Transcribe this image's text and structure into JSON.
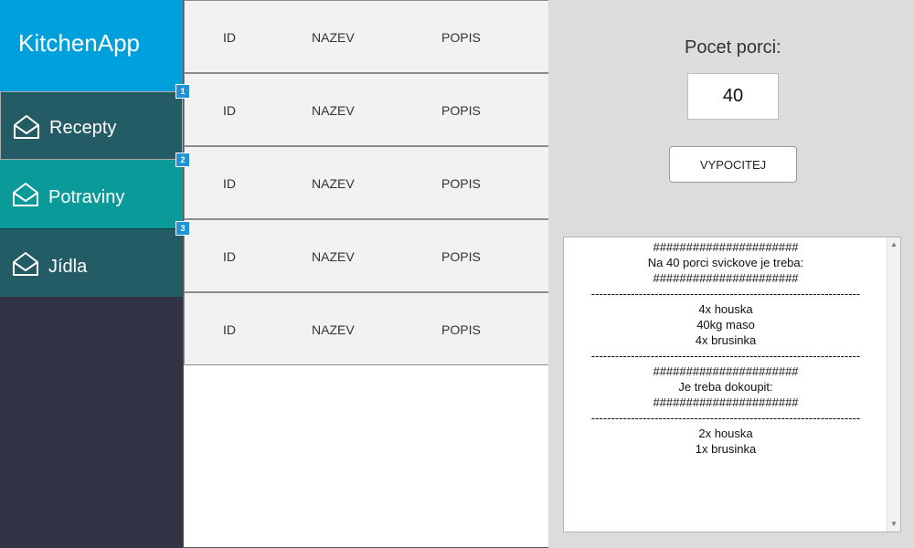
{
  "app": {
    "title": "KitchenApp"
  },
  "sidebar": {
    "items": [
      {
        "label": "Recepty",
        "badge": "1",
        "icon": "envelope-open-icon"
      },
      {
        "label": "Potraviny",
        "badge": "2",
        "icon": "envelope-open-icon"
      },
      {
        "label": "Jídla",
        "badge": "3",
        "icon": "envelope-open-icon"
      }
    ]
  },
  "list": {
    "rows": [
      {
        "id": "ID",
        "nazev": "NAZEV",
        "popis": "POPIS"
      },
      {
        "id": "ID",
        "nazev": "NAZEV",
        "popis": "POPIS"
      },
      {
        "id": "ID",
        "nazev": "NAZEV",
        "popis": "POPIS"
      },
      {
        "id": "ID",
        "nazev": "NAZEV",
        "popis": "POPIS"
      },
      {
        "id": "ID",
        "nazev": "NAZEV",
        "popis": "POPIS"
      }
    ]
  },
  "panel": {
    "portion_label": "Pocet porci:",
    "portion_value": "40",
    "calc_button": "VYPOCITEJ",
    "output_lines": [
      "######################",
      "Na 40 porci svickove je treba:",
      "######################",
      "--------------------------------------------------------------------",
      "4x houska",
      "40kg maso",
      "4x brusinka",
      "--------------------------------------------------------------------",
      "######################",
      "Je treba dokoupit:",
      "######################",
      "--------------------------------------------------------------------",
      "2x houska",
      "1x brusinka"
    ]
  },
  "colors": {
    "header": "#00a0dd",
    "sidebar": "#313445",
    "nav_dark": "#235c64",
    "nav_active": "#0b9a9a",
    "badge": "#1f93d8",
    "panel": "#dcdcdc"
  }
}
